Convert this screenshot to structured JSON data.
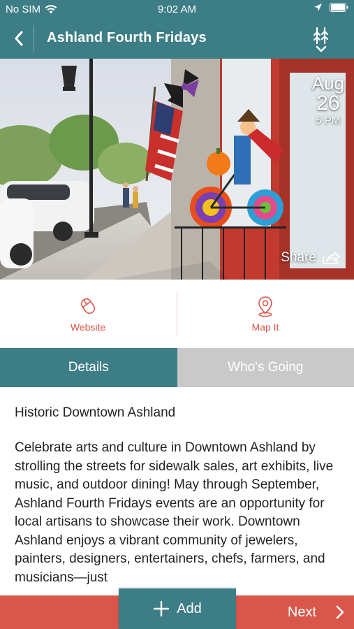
{
  "status_bar": {
    "carrier": "No SIM",
    "time": "9:02 AM"
  },
  "header": {
    "title": "Ashland Fourth Fridays"
  },
  "event": {
    "date_month": "Aug",
    "date_day": "26",
    "date_time": "5 PM",
    "share_label": "Share"
  },
  "actions": {
    "website_label": "Website",
    "map_label": "Map It"
  },
  "tabs": [
    {
      "label": "Details",
      "active": true
    },
    {
      "label": "Who's Going",
      "active": false
    }
  ],
  "details": {
    "venue": "Historic Downtown Ashland",
    "description": "Celebrate arts and culture in Downtown Ashland by strolling the streets for sidewalk sales, art exhibits, live music, and outdoor dining! May through September, Ashland Fourth Fridays events are an opportunity for local artisans to showcase their work. Downtown Ashland enjoys a vibrant community of jewelers, painters, designers, entertainers, chefs, farmers, and musicians—just"
  },
  "footer": {
    "add_label": "Add",
    "next_label": "Next"
  },
  "colors": {
    "primary": "#3d7d86",
    "accent": "#d9574a",
    "inactive_tab": "#c9c9c9"
  },
  "icons": [
    "back-arrow-icon",
    "wifi-icon",
    "location-arrow-icon",
    "battery-icon",
    "filter-icon",
    "share-icon",
    "mouse-icon",
    "map-pin-icon",
    "plus-icon",
    "chevron-right-icon"
  ]
}
